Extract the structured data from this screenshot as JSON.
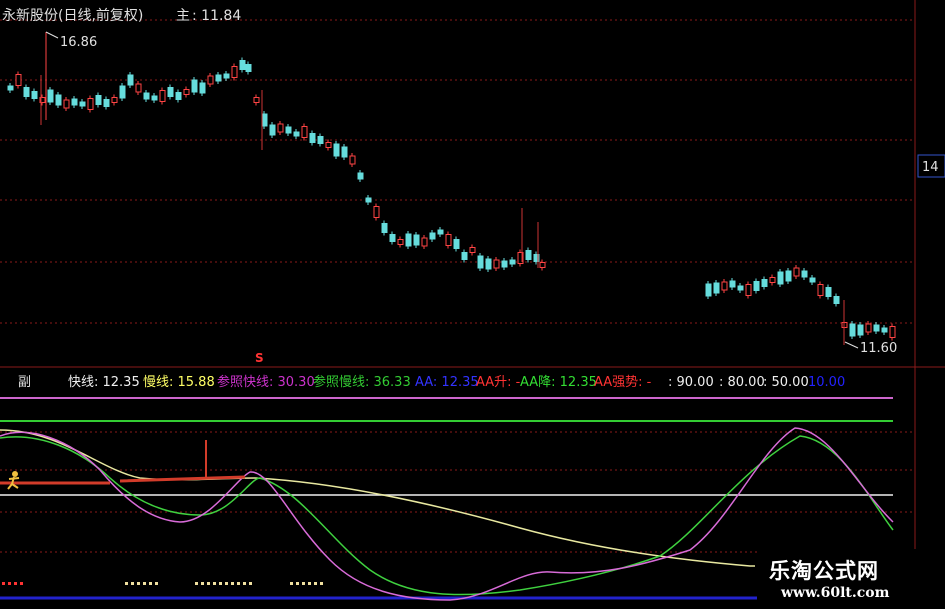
{
  "header": {
    "stock_title": "永新股份(日线,前复权)",
    "main_label": "主",
    "main_value": ": 11.84"
  },
  "price_annotations": {
    "high_label": "16.86",
    "low_label": "11.60",
    "axis_tag": "14"
  },
  "indicator_bar": {
    "panel_label": "副",
    "signal_marker": "S",
    "items": [
      {
        "label": "快线",
        "value": ": 12.35",
        "color": "#f0f0f0"
      },
      {
        "label": "慢线",
        "value": ": 15.88",
        "color": "#ffff66"
      },
      {
        "label": "参照快线",
        "value": ": 30.30",
        "color": "#cc33cc"
      },
      {
        "label": "参照慢线",
        "value": ": 36.33",
        "color": "#33cc33"
      },
      {
        "label": "AA",
        "value": ": 12.35",
        "color": "#3333ff"
      },
      {
        "label": "AA升",
        "value": ": -",
        "color": "#ff3333"
      },
      {
        "label": "AA降",
        "value": ": 12.35",
        "color": "#33dd33"
      },
      {
        "label": "AA强势",
        "value": ": -",
        "color": "#ff3333"
      },
      {
        "label": "",
        "value": ": 90.00",
        "color": "#f0f0f0"
      },
      {
        "label": "",
        "value": ": 80.00",
        "color": "#f0f0f0"
      },
      {
        "label": "",
        "value": ": 50.00",
        "color": "#f0f0f0"
      },
      {
        "label": "",
        "value": "10.00",
        "color": "#2222ff"
      }
    ]
  },
  "watermark": {
    "title": "乐淘公式网",
    "url": "www.60lt.com"
  },
  "colors": {
    "up_candle": "#ff4444",
    "down_candle": "#66dddd",
    "grid": "#8a1a1a",
    "fast_line": "#d86bd8",
    "slow_line": "#3fd03f",
    "ref_line": "#e8e8a0",
    "level_90": "#cc66cc",
    "level_80": "#33cc33",
    "level_50": "#f0f0f0",
    "level_10": "#2222cc"
  }
}
